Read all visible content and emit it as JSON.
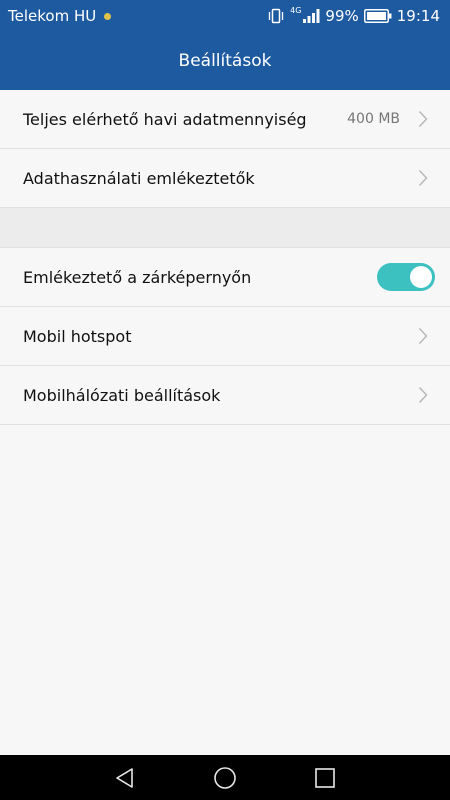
{
  "status_bar": {
    "carrier": "Telekom HU",
    "network_type": "4G",
    "battery_percent": "99%",
    "time": "19:14"
  },
  "header": {
    "title": "Beállítások"
  },
  "settings": {
    "items": [
      {
        "label": "Teljes elérhető havi adatmennyiség",
        "value": "400 MB"
      },
      {
        "label": "Adathasználati emlékeztetők"
      }
    ],
    "items2": [
      {
        "label": "Emlékeztető a zárképernyőn",
        "toggle_on": true
      },
      {
        "label": "Mobil hotspot"
      },
      {
        "label": "Mobilhálózati beállítások"
      }
    ]
  },
  "colors": {
    "header_bg": "#1e5aa0",
    "toggle_on": "#3cc0c0",
    "background": "#f7f7f7"
  }
}
